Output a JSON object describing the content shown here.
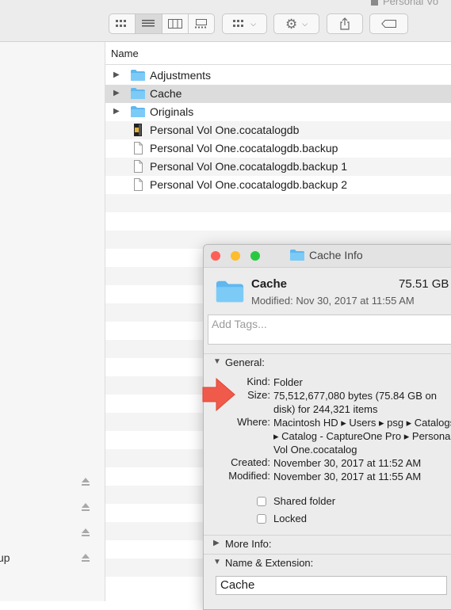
{
  "window": {
    "title": "Personal Vo"
  },
  "toolbar": {
    "view_modes": [
      "icons-view",
      "list-view",
      "columns-view",
      "gallery-view"
    ],
    "active_view": "list-view",
    "colors": {
      "button_bg": "#f8f8f8",
      "border": "#c9c9c9"
    }
  },
  "sidebar": {
    "items": [
      {
        "label": "",
        "eject": true
      },
      {
        "label": "",
        "eject": true
      },
      {
        "label": "",
        "eject": true
      },
      {
        "label": "up",
        "eject": true
      }
    ]
  },
  "file_list": {
    "column_header": "Name",
    "rows": [
      {
        "name": "Adjustments",
        "kind": "folder",
        "expandable": true,
        "selected": false
      },
      {
        "name": "Cache",
        "kind": "folder",
        "expandable": true,
        "selected": true
      },
      {
        "name": "Originals",
        "kind": "folder",
        "expandable": true,
        "selected": false
      },
      {
        "name": "Personal Vol One.cocatalogdb",
        "kind": "catalog",
        "expandable": false,
        "selected": false
      },
      {
        "name": "Personal Vol One.cocatalogdb.backup",
        "kind": "document",
        "expandable": false,
        "selected": false
      },
      {
        "name": "Personal Vol One.cocatalogdb.backup 1",
        "kind": "document",
        "expandable": false,
        "selected": false
      },
      {
        "name": "Personal Vol One.cocatalogdb.backup 2",
        "kind": "document",
        "expandable": false,
        "selected": false
      }
    ]
  },
  "info_window": {
    "title": "Cache Info",
    "traffic_lights": {
      "close": "#fd5f57",
      "minimize": "#febc2e",
      "zoom": "#29c840"
    },
    "name": "Cache",
    "size": "75.51 GB",
    "modified_line": "Modified: Nov 30, 2017 at 11:55 AM",
    "tags_placeholder": "Add Tags...",
    "general": {
      "title": "General:",
      "kind_label": "Kind:",
      "kind_value": "Folder",
      "size_label": "Size:",
      "size_value": "75,512,677,080 bytes (75.84 GB on disk) for 244,321 items",
      "where_label": "Where:",
      "where_value": "Macintosh HD ▸ Users ▸ psg ▸ Catalogs ▸ Catalog - CaptureOne Pro ▸ Personal Vol One.cocatalog",
      "created_label": "Created:",
      "created_value": "November 30, 2017 at 11:52 AM",
      "modified_label": "Modified:",
      "modified_value": "November 30, 2017 at 11:55 AM",
      "shared_folder_label": "Shared folder",
      "shared_folder_checked": false,
      "locked_label": "Locked",
      "locked_checked": false
    },
    "more_info": {
      "title": "More Info:"
    },
    "name_extension": {
      "title": "Name & Extension:",
      "value": "Cache"
    },
    "annotation_color": "#f05a4a"
  }
}
